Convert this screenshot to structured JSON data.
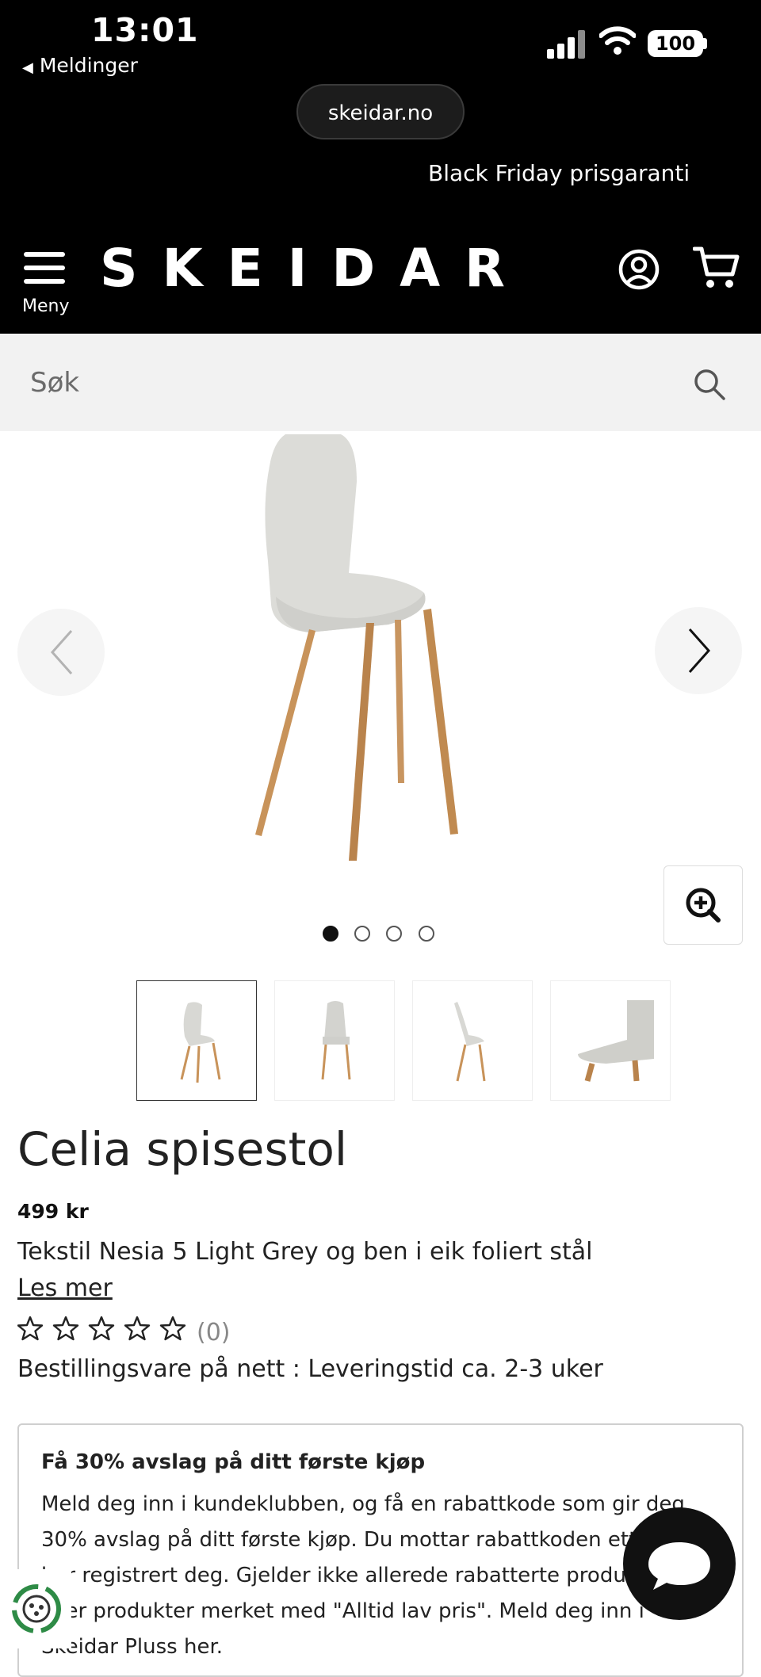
{
  "status_bar": {
    "time": "13:01",
    "back_label": "Meldinger",
    "battery": "100"
  },
  "browser": {
    "url": "skeidar.no"
  },
  "header": {
    "promo": "Black Friday prisgaranti",
    "menu_label": "Meny",
    "logo": "SKEIDAR"
  },
  "search": {
    "placeholder": "Søk"
  },
  "gallery": {
    "dot_count": 4,
    "active_dot": 0,
    "thumbnail_count": 4
  },
  "product": {
    "title": "Celia spisestol",
    "price": "499 kr",
    "description": "Tekstil Nesia 5 Light Grey og ben i eik foliert stål",
    "read_more": "Les mer",
    "rating_stars": 0,
    "rating_count": "(0)",
    "delivery": "Bestillingsvare på nett : Leveringstid ca. 2-3 uker"
  },
  "club": {
    "title": "Få 30% avslag på ditt første kjøp",
    "text": "Meld deg inn i kundeklubben, og få en rabattkode som gir deg 30% avslag på ditt første kjøp. Du mottar rabattkoden etter du har registrert deg. Gjelder ikke allerede rabatterte produktens eller produkter merket med \"Alltid lav pris\". Meld deg inn i Skeidar Pluss her."
  },
  "colors": {
    "header_bg": "#000000",
    "search_bg": "#f2f2f2",
    "text": "#222222"
  }
}
